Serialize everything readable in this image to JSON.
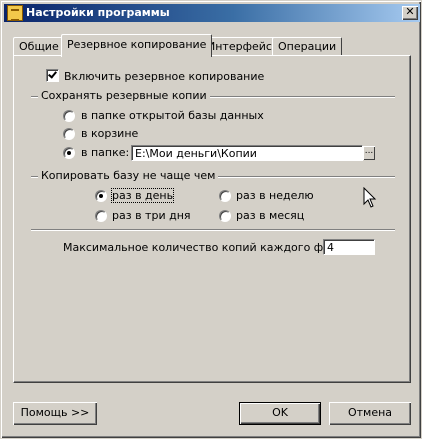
{
  "window": {
    "title": "Настройки программы",
    "close_glyph": "✕"
  },
  "tabs": [
    {
      "label": "Общие",
      "active": false
    },
    {
      "label": "Резервное копирование",
      "active": true
    },
    {
      "label": "Интерфейс",
      "active": false
    },
    {
      "label": "Операции",
      "active": false
    }
  ],
  "backup": {
    "enable_label": "Включить резервное копирование",
    "enable_checked": true,
    "save_group_label": "Сохранять резервные копии",
    "save_options": [
      {
        "label": "в папке открытой базы данных",
        "selected": false
      },
      {
        "label": "в корзине",
        "selected": false
      },
      {
        "label": "в папке:",
        "selected": true
      }
    ],
    "folder_path": "E:\\Мои деньги\\Копии",
    "browse_label": "...",
    "frequency_group_label": "Копировать базу не чаще чем",
    "frequency_options": [
      {
        "label": "раз в день",
        "selected": true
      },
      {
        "label": "раз в неделю",
        "selected": false
      },
      {
        "label": "раз в три дня",
        "selected": false
      },
      {
        "label": "раз в месяц",
        "selected": false
      }
    ],
    "max_copies_label": "Максимальное количество копий каждого файла:",
    "max_copies_value": "4"
  },
  "footer": {
    "help_label": "Помощь >>",
    "ok_label": "OK",
    "cancel_label": "Отмена"
  },
  "icons": {
    "app": "app-icon",
    "close": "close-icon",
    "cursor": "mouse-cursor-icon"
  }
}
